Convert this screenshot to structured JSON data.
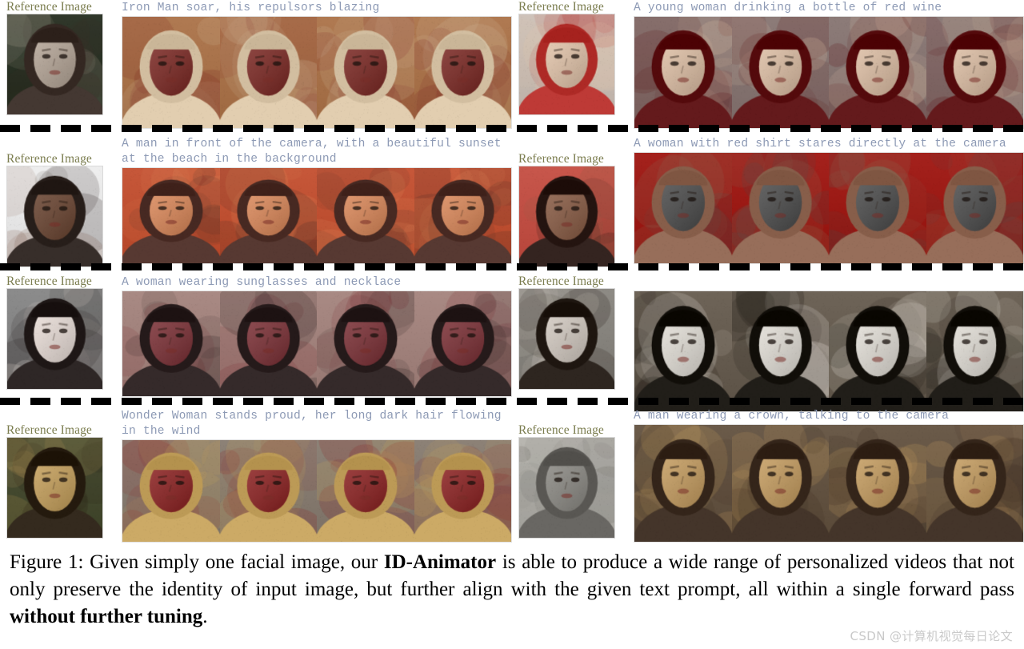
{
  "figure": {
    "reference_label": "Reference Image",
    "rows": [
      {
        "id": "row-ironman",
        "reference_label": "Reference Image",
        "prompt": "Iron Man soar, his repulsors blazing",
        "subject": "man-with-glasses",
        "ref_palette": [
          "#2f3a2c",
          "#b9a99a",
          "#3a2e28"
        ],
        "frame_palette": [
          "#b07a52",
          "#7d2722",
          "#d8c4a6"
        ],
        "frames": 4
      },
      {
        "id": "row-wine",
        "reference_label": "Reference Image",
        "prompt": "A young woman drinking a bottle of red wine",
        "subject": "blonde-woman",
        "ref_palette": [
          "#cfc3ba",
          "#e8c9ae",
          "#b4302c"
        ],
        "frame_palette": [
          "#8d7c79",
          "#e3c3a8",
          "#5a1012"
        ],
        "frames": 4
      },
      {
        "id": "row-beach",
        "reference_label": "Reference Image",
        "prompt": "A man in front of the camera, with a beautiful sunset at the beach in the background",
        "subject": "smiling-man",
        "ref_palette": [
          "#efefef",
          "#6b4430",
          "#2d2420"
        ],
        "frame_palette": [
          "#c7583a",
          "#e08a5a",
          "#4d2f28"
        ],
        "frames": 4
      },
      {
        "id": "row-redshirt",
        "reference_label": "Reference Image",
        "prompt": "A woman with red shirt stares directly at the camera",
        "subject": "woman-red-background",
        "ref_palette": [
          "#c8574c",
          "#8b5c44",
          "#2a1a16"
        ],
        "frame_palette": [
          "#a4221d",
          "#4c4c4c",
          "#8d6450"
        ],
        "frames": 4
      },
      {
        "id": "row-sunglasses",
        "reference_label": "Reference Image",
        "prompt": "A woman wearing sunglasses and necklace",
        "subject": "pale-woman-dark-hair",
        "ref_palette": [
          "#8c8c8c",
          "#efe3dd",
          "#241d1c"
        ],
        "frame_palette": [
          "#a98a84",
          "#7d2f35",
          "#2b2020"
        ],
        "frames": 4
      },
      {
        "id": "row-glove",
        "reference_label": "Reference Image",
        "prompt": "",
        "subject": "asian-man",
        "ref_palette": [
          "#8e8b85",
          "#d8cfc6",
          "#241c16"
        ],
        "frame_palette": [
          "#6e6458",
          "#e8e4dc",
          "#17140f"
        ],
        "frames": 4
      },
      {
        "id": "row-wonderwoman",
        "reference_label": "Reference Image",
        "prompt": "Wonder Woman stands proud, her long dark hair flowing in the wind",
        "subject": "mona-lisa",
        "ref_palette": [
          "#4d5238",
          "#caa35c",
          "#2a2014"
        ],
        "frame_palette": [
          "#8d8277",
          "#8e2020",
          "#c2a05c"
        ],
        "frames": 4
      },
      {
        "id": "row-crown",
        "reference_label": "Reference Image",
        "prompt": "A man wearing a crown, talking to the camera",
        "subject": "marble-bust",
        "ref_palette": [
          "#b9b7b1",
          "#8e8c86",
          "#5f5d59"
        ],
        "frame_palette": [
          "#6b5b4a",
          "#caa061",
          "#3a2b20"
        ],
        "frames": 4
      }
    ]
  },
  "caption": {
    "prefix": "Figure 1: Given simply one facial image, our ",
    "bold1": "ID-Animator",
    "middle": " is able to produce a wide range of personalized videos that not only preserve the identity of input image, but further align with the given text prompt, all within a single forward pass ",
    "bold2": "without further tuning",
    "suffix": "."
  },
  "watermark": {
    "text": "CSDN @计算机视觉每日论文"
  },
  "colors": {
    "reference_label": "#7b7d4f",
    "prompt_text": "#8d9ab5",
    "caption_text": "#000000",
    "watermark_text": "#c9c9c9",
    "divider": "#000000",
    "background": "#ffffff"
  }
}
